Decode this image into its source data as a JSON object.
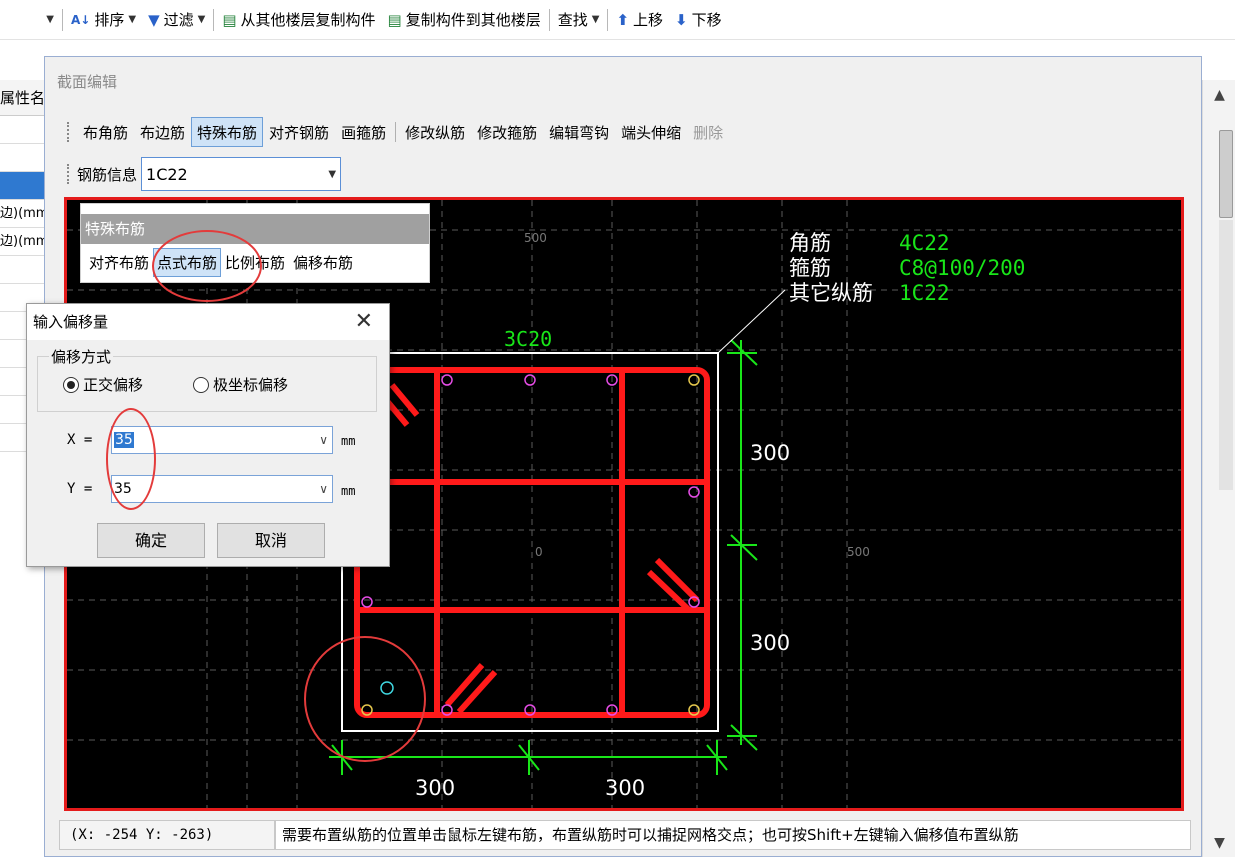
{
  "top_toolbar": {
    "sort_label": "排序",
    "filter_label": "过滤",
    "copy_from_floor": "从其他楼层复制构件",
    "copy_to_floor": "复制构件到其他楼层",
    "find_label": "查找",
    "move_up": "上移",
    "move_down": "下移"
  },
  "left_panel": {
    "header": "属性名",
    "rows": [
      "",
      "",
      "",
      "边)(mm",
      "边)(mm",
      "",
      "",
      "",
      "",
      "",
      "",
      "",
      ""
    ]
  },
  "editor": {
    "title": "截面编辑",
    "tools": [
      "布角筋",
      "布边筋",
      "特殊布筋",
      "对齐钢筋",
      "画箍筋",
      "修改纵筋",
      "修改箍筋",
      "编辑弯钩",
      "端头伸缩",
      "删除"
    ],
    "active_tool": "特殊布筋",
    "rebar_info_label": "钢筋信息",
    "rebar_info_value": "1C22"
  },
  "special_panel": {
    "title": "特殊布筋",
    "options": [
      "对齐布筋",
      "点式布筋",
      "比例布筋",
      "偏移布筋"
    ],
    "active": "点式布筋"
  },
  "dialog": {
    "title": "输入偏移量",
    "group_label": "偏移方式",
    "radio_orthogonal": "正交偏移",
    "radio_polar": "极坐标偏移",
    "x_label": "X =",
    "x_value": "35",
    "x_unit": "mm",
    "y_label": "Y =",
    "y_value": "35",
    "y_unit": "mm",
    "ok": "确定",
    "cancel": "取消"
  },
  "drawing": {
    "legend": [
      {
        "name": "角筋",
        "value": "4C22"
      },
      {
        "name": "箍筋",
        "value": "C8@100/200"
      },
      {
        "name": "其它纵筋",
        "value": "1C22"
      }
    ],
    "top_label": "3C20",
    "dims_right": [
      "300",
      "300"
    ],
    "dims_bottom": [
      "300",
      "300"
    ],
    "axis_labels": [
      "500",
      "0",
      "500"
    ],
    "colors": {
      "stirrup": "#ff1a1a",
      "dimension": "#19e619",
      "outline": "#ffffff",
      "grid": "#5a5a5a"
    }
  },
  "status": {
    "coords": "(X: -254 Y: -263)",
    "hint": "需要布置纵筋的位置单击鼠标左键布筋，布置纵筋时可以捕捉网格交点；也可按Shift+左键输入偏移值布置纵筋"
  }
}
